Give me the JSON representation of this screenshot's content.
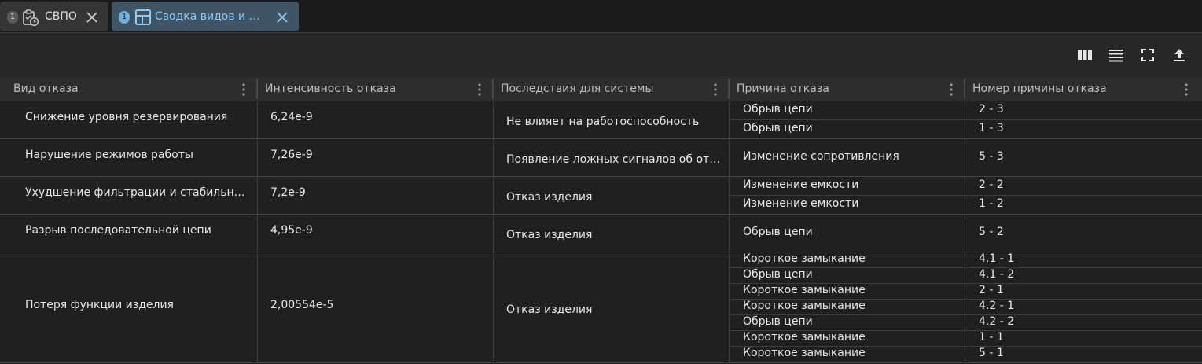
{
  "tabs": [
    {
      "badge": "1",
      "label": "СВПО",
      "icon": "clipboard-clock-icon"
    },
    {
      "badge": "1",
      "label": "Сводка видов и по...",
      "icon": "dashboard-layout-icon"
    }
  ],
  "toolbar": {
    "buttons": [
      "columns-icon",
      "rows-icon",
      "fullscreen-icon",
      "export-upload-icon"
    ]
  },
  "table": {
    "columns": [
      "Вид отказа",
      "Интенсивность отказа",
      "Последствия для системы",
      "Причина отказа",
      "Номер причины отказа"
    ],
    "rows": [
      {
        "mode": "Снижение уровня резервирования",
        "intensity": "6,24e-9",
        "consequence": "Не влияет на работоспособность",
        "causes": [
          {
            "cause": "Обрыв цепи",
            "number": "2 - 3"
          },
          {
            "cause": "Обрыв цепи",
            "number": "1 - 3"
          }
        ]
      },
      {
        "mode": "Нарушение режимов работы",
        "intensity": "7,26e-9",
        "consequence": "Появление ложных сигналов об отк...",
        "causes": [
          {
            "cause": "Изменение сопротивления",
            "number": "5 - 3"
          }
        ]
      },
      {
        "mode": "Ухудшение фильтрации и стабильности",
        "intensity": "7,2e-9",
        "consequence": "Отказ изделия",
        "causes": [
          {
            "cause": "Изменение емкости",
            "number": "2 - 2"
          },
          {
            "cause": "Изменение емкости",
            "number": "1 - 2"
          }
        ]
      },
      {
        "mode": "Разрыв последовательной цепи",
        "intensity": "4,95e-9",
        "consequence": "Отказ изделия",
        "causes": [
          {
            "cause": "Обрыв цепи",
            "number": "5 - 2"
          }
        ]
      },
      {
        "mode": "Потеря функции изделия",
        "intensity": "2,00554e-5",
        "consequence": "Отказ изделия",
        "causes": [
          {
            "cause": "Короткое замыкание",
            "number": "4.1 - 1"
          },
          {
            "cause": "Обрыв цепи",
            "number": "4.1 - 2"
          },
          {
            "cause": "Короткое замыкание",
            "number": "2 - 1"
          },
          {
            "cause": "Короткое замыкание",
            "number": "4.2 - 1"
          },
          {
            "cause": "Обрыв цепи",
            "number": "4.2 - 2"
          },
          {
            "cause": "Короткое замыкание",
            "number": "1 - 1"
          },
          {
            "cause": "Короткое замыкание",
            "number": "5 - 1"
          }
        ]
      }
    ]
  },
  "colors": {
    "active_tab": "#3f5566",
    "active_tab_text": "#8fcaf2",
    "panel": "#272727",
    "grid_body": "#202020"
  }
}
